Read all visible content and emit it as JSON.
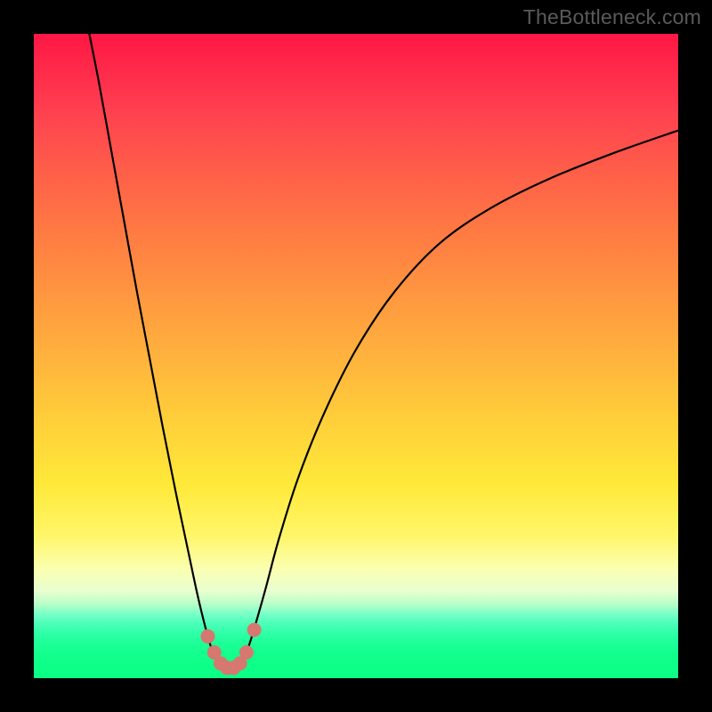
{
  "watermark": "TheBottleneck.com",
  "chart_data": {
    "type": "line",
    "title": "",
    "xlabel": "",
    "ylabel": "",
    "xlim": [
      0,
      100
    ],
    "ylim": [
      0,
      100
    ],
    "grid": false,
    "gradient_bands": [
      {
        "color": "#ff1744",
        "stop": 0
      },
      {
        "color": "#ff7843",
        "stop": 30
      },
      {
        "color": "#ffe93a",
        "stop": 70
      },
      {
        "color": "#0aff84",
        "stop": 100
      }
    ],
    "series": [
      {
        "name": "left-curve",
        "x": [
          8.0,
          10.0,
          12.0,
          14.0,
          16.0,
          18.0,
          20.0,
          22.0,
          24.0,
          25.5,
          27.0,
          28.0,
          29.0
        ],
        "y": [
          103.0,
          93.0,
          82.0,
          71.0,
          60.0,
          49.5,
          39.0,
          29.0,
          19.5,
          12.5,
          6.5,
          3.5,
          2.0
        ]
      },
      {
        "name": "right-curve",
        "x": [
          32.0,
          33.0,
          34.0,
          36.0,
          38.0,
          41.0,
          45.0,
          50.0,
          56.0,
          63.0,
          71.0,
          80.0,
          90.0,
          100.0
        ],
        "y": [
          2.0,
          4.0,
          7.0,
          14.0,
          21.5,
          31.0,
          41.0,
          51.0,
          60.0,
          67.5,
          73.0,
          77.5,
          81.5,
          85.0
        ]
      },
      {
        "name": "valley-floor",
        "x": [
          29.0,
          30.0,
          31.0,
          32.0
        ],
        "y": [
          2.0,
          1.5,
          1.5,
          2.0
        ]
      }
    ],
    "markers": {
      "name": "salmon-dots",
      "color": "#d6786f",
      "points": [
        {
          "x": 27.0,
          "y": 6.5
        },
        {
          "x": 28.0,
          "y": 4.0
        },
        {
          "x": 29.0,
          "y": 2.3
        },
        {
          "x": 30.0,
          "y": 1.6
        },
        {
          "x": 31.0,
          "y": 1.6
        },
        {
          "x": 32.0,
          "y": 2.3
        },
        {
          "x": 33.0,
          "y": 4.0
        },
        {
          "x": 34.2,
          "y": 7.5
        }
      ]
    }
  }
}
